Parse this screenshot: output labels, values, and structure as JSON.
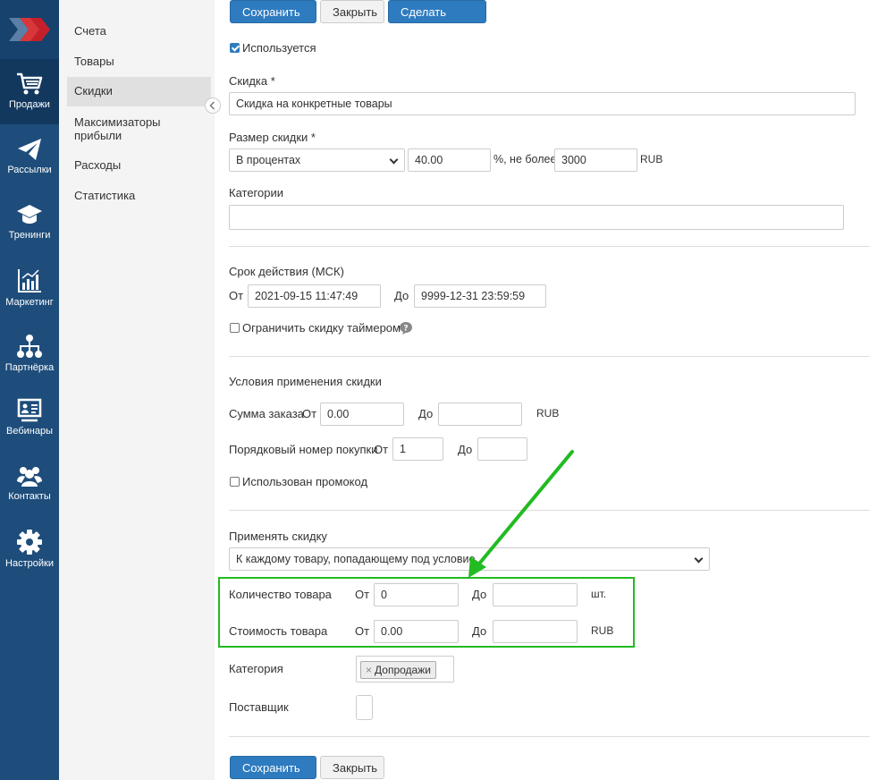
{
  "nav": {
    "items": [
      {
        "label": "Продажи",
        "icon": "cart-icon",
        "active": true
      },
      {
        "label": "Рассылки",
        "icon": "paper-plane-icon"
      },
      {
        "label": "Тренинги",
        "icon": "graduation-cap-icon"
      },
      {
        "label": "Маркетинг",
        "icon": "bar-chart-icon"
      },
      {
        "label": "Партнёрка",
        "icon": "network-icon"
      },
      {
        "label": "Вебинары",
        "icon": "presentation-icon"
      },
      {
        "label": "Контакты",
        "icon": "users-icon"
      },
      {
        "label": "Настройки",
        "icon": "gear-icon"
      }
    ]
  },
  "subnav": {
    "items": [
      {
        "label": "Счета"
      },
      {
        "label": "Товары"
      },
      {
        "label": "Скидки",
        "active": true
      },
      {
        "label": "Максимизаторы прибыли"
      },
      {
        "label": "Расходы"
      },
      {
        "label": "Статистика"
      }
    ]
  },
  "toolbar": {
    "save": "Сохранить",
    "close": "Закрыть",
    "copy": "Сделать копию"
  },
  "form": {
    "used_label": "Используется",
    "used_checked": true,
    "discount_label": "Скидка",
    "discount_value": "Скидка на конкретные товары",
    "size_label": "Размер скидки",
    "size_type": "В процентах",
    "size_value": "40.00",
    "not_more": "%, не более",
    "max_value": "3000",
    "currency": "RUB",
    "categories_label": "Категории",
    "validity_label": "Срок действия (МСК)",
    "from": "От",
    "to": "До",
    "valid_from": "2021-09-15 11:47:49",
    "valid_to": "9999-12-31 23:59:59",
    "timer_label": "Ограничить скидку таймером",
    "conditions_label": "Условия применения скидки",
    "order_sum_label": "Сумма заказа",
    "order_sum_from": "0.00",
    "order_sum_to": "",
    "purchase_no_label": "Порядковый номер покупки",
    "purchase_no_from": "1",
    "purchase_no_to": "",
    "promo_label": "Использован промокод",
    "apply_label": "Применять скидку",
    "apply_value": "К каждому товару, попадающему под условие",
    "qty_label": "Количество товара",
    "qty_from": "0",
    "qty_to": "",
    "qty_unit": "шт.",
    "cost_label": "Стоимость товара",
    "cost_from": "0.00",
    "cost_to": "",
    "category_label": "Категория",
    "category_tag": "Допродажи",
    "supplier_label": "Поставщик"
  },
  "annotation": {
    "color": "#22bb22"
  }
}
